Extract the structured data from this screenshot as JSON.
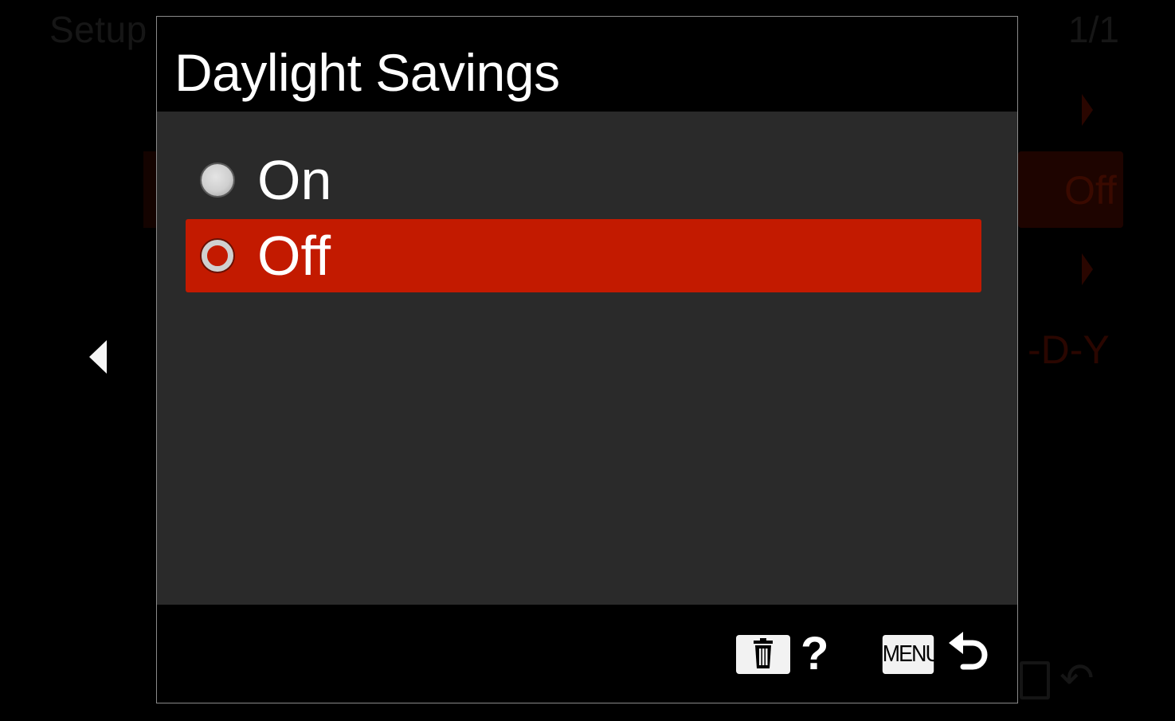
{
  "background": {
    "title": "Setup",
    "page_indicator": "1/1",
    "value": "Off",
    "date_format": "-D-Y"
  },
  "dialog": {
    "title": "Daylight Savings",
    "options": [
      {
        "label": "On",
        "selected": false
      },
      {
        "label": "Off",
        "selected": true
      }
    ],
    "footer": {
      "help_label": "?",
      "menu_label": "MENU"
    }
  },
  "colors": {
    "selection": "#c31a00",
    "body": "#2a2a2a",
    "header": "#000000"
  },
  "icons": [
    "left-arrow-icon",
    "trash-icon",
    "help-icon",
    "menu-button-icon",
    "return-icon"
  ]
}
